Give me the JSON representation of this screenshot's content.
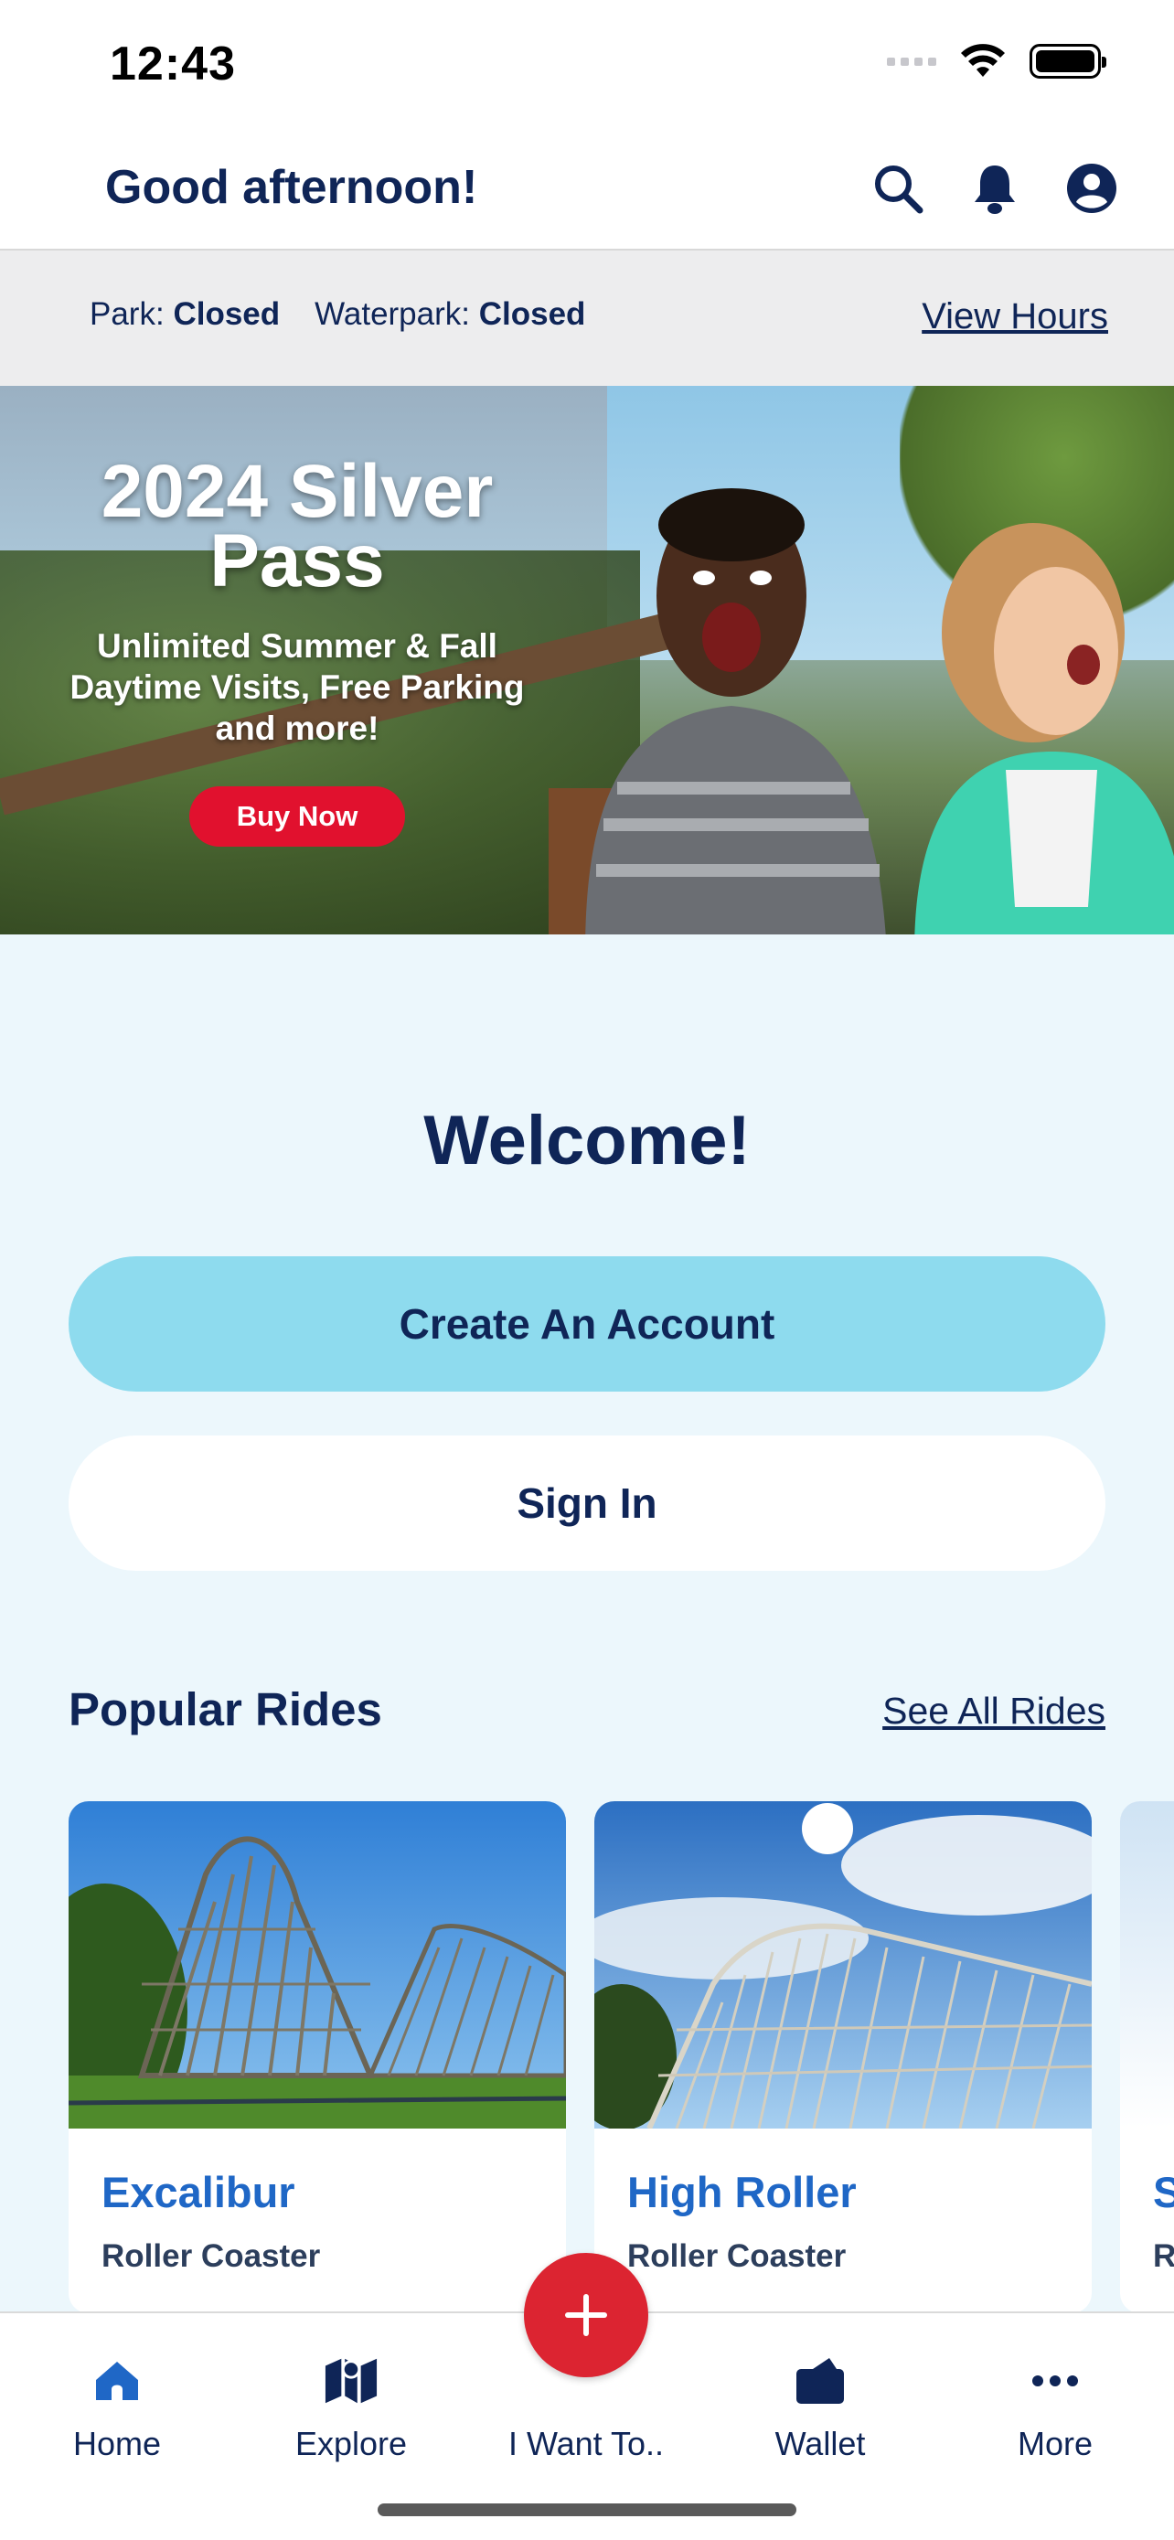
{
  "status_bar": {
    "time": "12:43"
  },
  "header": {
    "greeting": "Good afternoon!"
  },
  "hours": {
    "park_label": "Park:",
    "park_status": "Closed",
    "waterpark_label": "Waterpark:",
    "waterpark_status": "Closed",
    "view_hours": "View Hours"
  },
  "banner": {
    "title": "2024 Silver Pass",
    "subtitle": "Unlimited Summer & Fall Daytime Visits, Free Parking and more!",
    "button": "Buy Now"
  },
  "welcome": {
    "title": "Welcome!",
    "create_account": "Create An Account",
    "sign_in": "Sign In"
  },
  "popular_rides": {
    "title": "Popular Rides",
    "see_all": "See All Rides",
    "items": [
      {
        "name": "Excalibur",
        "type": "Roller Coaster"
      },
      {
        "name": "High Roller",
        "type": "Roller Coaster"
      },
      {
        "name": "S",
        "type": "R"
      }
    ]
  },
  "tabbar": {
    "items": [
      {
        "label": "Home",
        "icon": "home-icon"
      },
      {
        "label": "Explore",
        "icon": "map-icon"
      },
      {
        "label": "I Want To..",
        "icon": "plus-icon"
      },
      {
        "label": "Wallet",
        "icon": "wallet-icon"
      },
      {
        "label": "More",
        "icon": "more-icon"
      }
    ]
  },
  "colors": {
    "navy": "#0f2557",
    "accent_blue": "#1f67c6",
    "create_button": "#8edbee",
    "fab_red": "#dc2431",
    "banner_button": "#e1112e",
    "content_bg": "#ecf7fc"
  }
}
